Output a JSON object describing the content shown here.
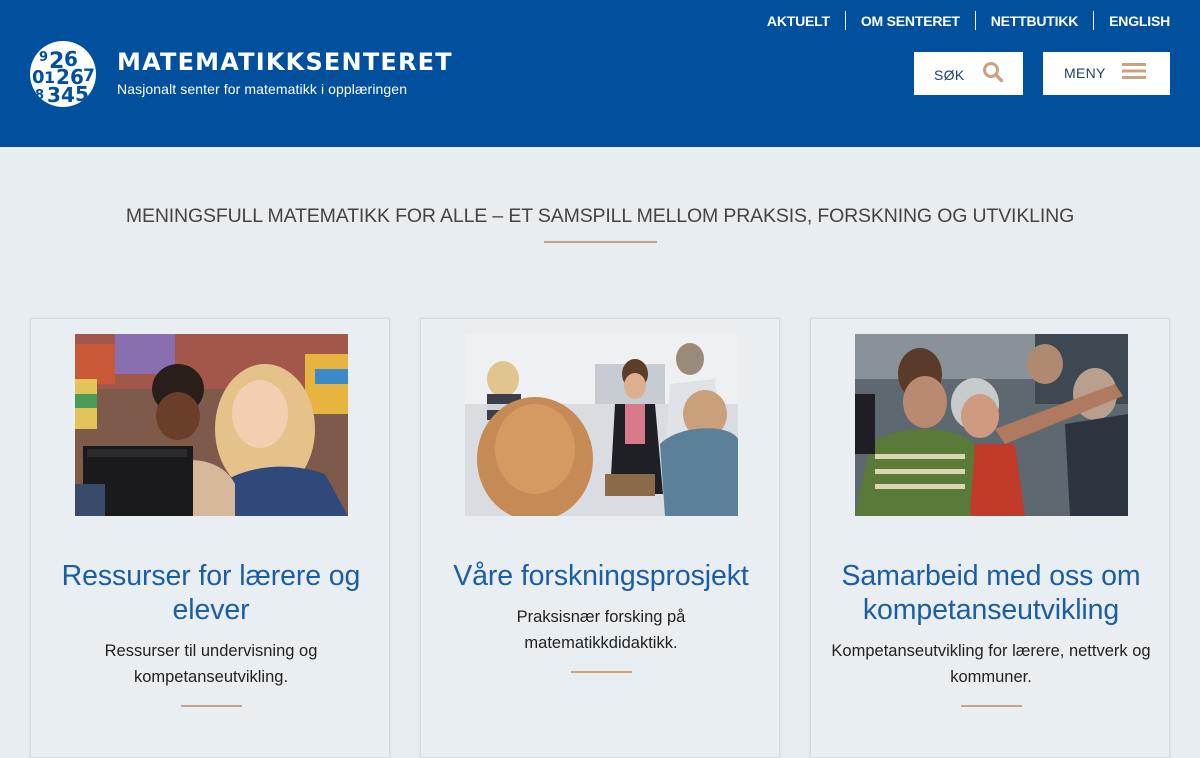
{
  "header": {
    "top_nav": [
      "AKTUELT",
      "OM SENTERET",
      "NETTBUTIKK",
      "ENGLISH"
    ],
    "logo": {
      "digits": [
        "9",
        "2",
        "6",
        "0",
        "1",
        "2",
        "6",
        "7",
        "8",
        "3",
        "4",
        "5"
      ],
      "name": "MATEMATIKKSENTERET",
      "subtitle": "Nasjonalt senter for matematikk i opplæringen"
    },
    "search_label": "SØK",
    "menu_label": "MENY"
  },
  "tagline": "MENINGSFULL MATEMATIKK FOR ALLE – ET SAMSPILL MELLOM PRAKSIS, FORSKNING OG UTVIKLING",
  "cards": [
    {
      "title": "Ressurser for lærere og elever",
      "description": "Ressurser til undervisning og kompetanseutvikling."
    },
    {
      "title": "Våre forskningsprosjekt",
      "description": "Praksisnær forsking på matematikkdidaktikk."
    },
    {
      "title": "Samarbeid med oss om kompetanseutvikling",
      "description": "Kompetanseutvikling for lærere, nettverk og kommuner."
    }
  ],
  "colors": {
    "brand_blue": "#00509e",
    "accent": "#c9a184",
    "page_bg": "#e8edf1",
    "link_blue": "#1d5da1"
  }
}
